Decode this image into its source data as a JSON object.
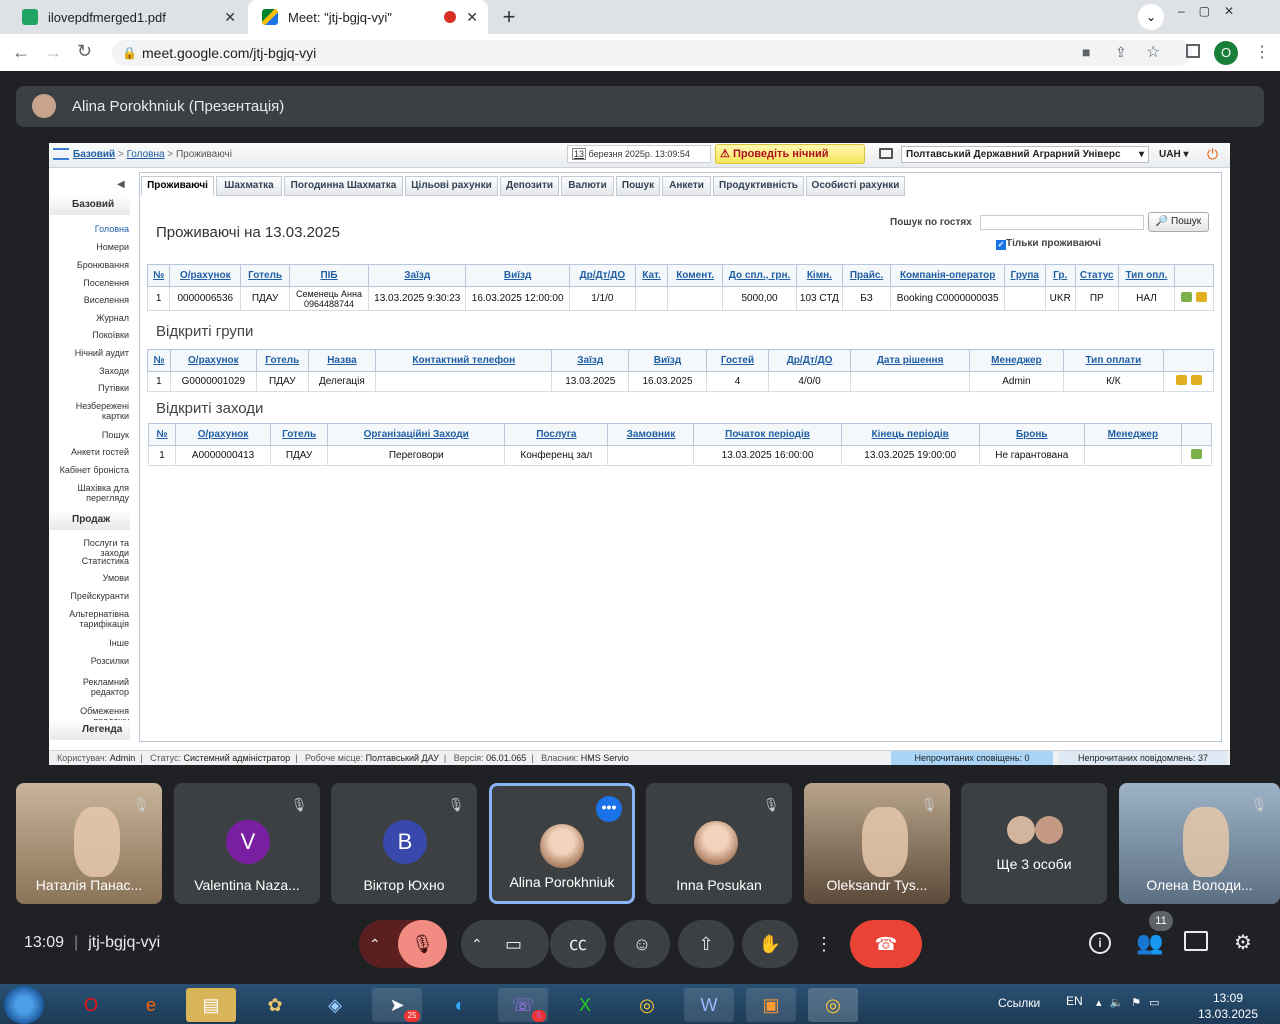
{
  "browser": {
    "tabs": [
      {
        "label": "ilovepdfmerged1.pdf"
      },
      {
        "label": "Meet: \"jtj-bgjq-vyi\""
      }
    ],
    "url": "meet.google.com/jtj-bgjq-vyi",
    "profile_initial": "O"
  },
  "meet": {
    "presenter_label": "Alina Porokhniuk (Презентація)",
    "time": "13:09",
    "meeting_code": "jtj-bgjq-vyi",
    "participants_count": "11",
    "tiles": [
      {
        "name": "Наталія Панас...",
        "kind": "video"
      },
      {
        "name": "Valentina Naza...",
        "initial": "V",
        "color": "#7b1fa2"
      },
      {
        "name": "Віктор Юхно",
        "initial": "B",
        "color": "#3949ab"
      },
      {
        "name": "Alina Porokhniuk",
        "kind": "photo"
      },
      {
        "name": "Inna Posukan",
        "kind": "photo"
      },
      {
        "name": "Oleksandr Tys...",
        "kind": "video"
      },
      {
        "name": "Ще 3 особи",
        "kind": "group"
      },
      {
        "name": "Олена Володи...",
        "kind": "video"
      }
    ]
  },
  "hms": {
    "breadcrumb": {
      "root": "Базовий",
      "home": "Головна",
      "current": "Проживаючі"
    },
    "date": "березня 2025р.  13:09:54",
    "date_day": "13",
    "night_audit": "Проведіть нічний",
    "hotel": "Полтавський Державний Аграрний Універс",
    "currency": "UAH",
    "sidebar": {
      "section1": "Базовий",
      "items1": [
        "Головна",
        "Номери",
        "Бронювання",
        "Поселення",
        "Виселення",
        "Журнал",
        "Покоївки",
        "Нічний аудит",
        "Заходи",
        "Путівки",
        "Незбережені картки",
        "Пошук",
        "Анкети гостей",
        "Кабінет броніста",
        "Шахівка для перегляду"
      ],
      "section2": "Продаж",
      "items2": [
        "Послуги та заходи",
        "Статистика",
        "Умови",
        "Прейскуранти",
        "Альтернатівна тарифікація",
        "Інше",
        "Розсилки",
        "Рекламний редактор",
        "Обмеження продажу"
      ],
      "section3": "Легенда"
    },
    "tabs": [
      "Проживаючі",
      "Шахматка",
      "Погодинна Шахматка",
      "Цільові рахунки",
      "Депозити",
      "Валюти",
      "Пошук",
      "Анкети",
      "Продуктивність",
      "Особисті рахунки"
    ],
    "title": "Проживаючі на 13.03.2025",
    "search_label": "Пошук по гостях",
    "search_button": "Пошук",
    "only_living": "Тільки проживаючі",
    "residents": {
      "headers": [
        "№",
        "О/рахунок",
        "Готель",
        "ПІБ",
        "Заїзд",
        "Виїзд",
        "Др/Дт/ДО",
        "Кат.",
        "Комент.",
        "До спл., грн.",
        "Кімн.",
        "Прайс.",
        "Компанія-оператор",
        "Група",
        "Гр.",
        "Статус",
        "Тип опл."
      ],
      "rows": [
        [
          "1",
          "0000006536",
          "ПДАУ",
          "Семенець Анна 0964488744",
          "13.03.2025 9:30:23",
          "16.03.2025 12:00:00",
          "1/1/0",
          "",
          "",
          "5000,00",
          "103 СТД",
          "БЗ",
          "Booking C0000000035",
          "",
          "UKR",
          "ПР",
          "НАЛ"
        ]
      ]
    },
    "groups_title": "Відкриті групи",
    "groups": {
      "headers": [
        "№",
        "О/рахунок",
        "Готель",
        "Назва",
        "Контактний телефон",
        "Заїзд",
        "Виїзд",
        "Гостей",
        "Др/Дт/ДО",
        "Дата рішення",
        "Менеджер",
        "Тип оплати"
      ],
      "rows": [
        [
          "1",
          "G0000001029",
          "ПДАУ",
          "Делегація",
          "",
          "13.03.2025",
          "16.03.2025",
          "4",
          "4/0/0",
          "",
          "Admin",
          "К/К"
        ]
      ]
    },
    "events_title": "Відкриті заходи",
    "events": {
      "headers": [
        "№",
        "О/рахунок",
        "Готель",
        "Організаційні Заходи",
        "Послуга",
        "Замовник",
        "Початок періодів",
        "Кінець періодів",
        "Бронь",
        "Менеджер"
      ],
      "rows": [
        [
          "1",
          "A0000000413",
          "ПДАУ",
          "Переговори",
          "Конференц зал",
          "",
          "13.03.2025 16:00:00",
          "13.03.2025 19:00:00",
          "Не гарантована",
          ""
        ]
      ]
    },
    "status": {
      "user_label": "Користувач:",
      "user": "Admin",
      "status_label": "Статус:",
      "status": "Системний адміністратор",
      "place_label": "Робоче місце:",
      "place": "Полтавський ДАУ",
      "version_label": "Версія:",
      "version": "06.01.065",
      "owner_label": "Власник:",
      "owner": "HMS Servio",
      "unread_notifications": "Непрочитаних сповіщень: 0",
      "unread_messages": "Непрочитаних повідомлень: 37"
    }
  },
  "taskbar": {
    "links": "Ссылки",
    "lang": "EN",
    "clock_time": "13:09",
    "clock_date": "13.03.2025",
    "telegram_badge": "25",
    "viber_badge": "5"
  }
}
